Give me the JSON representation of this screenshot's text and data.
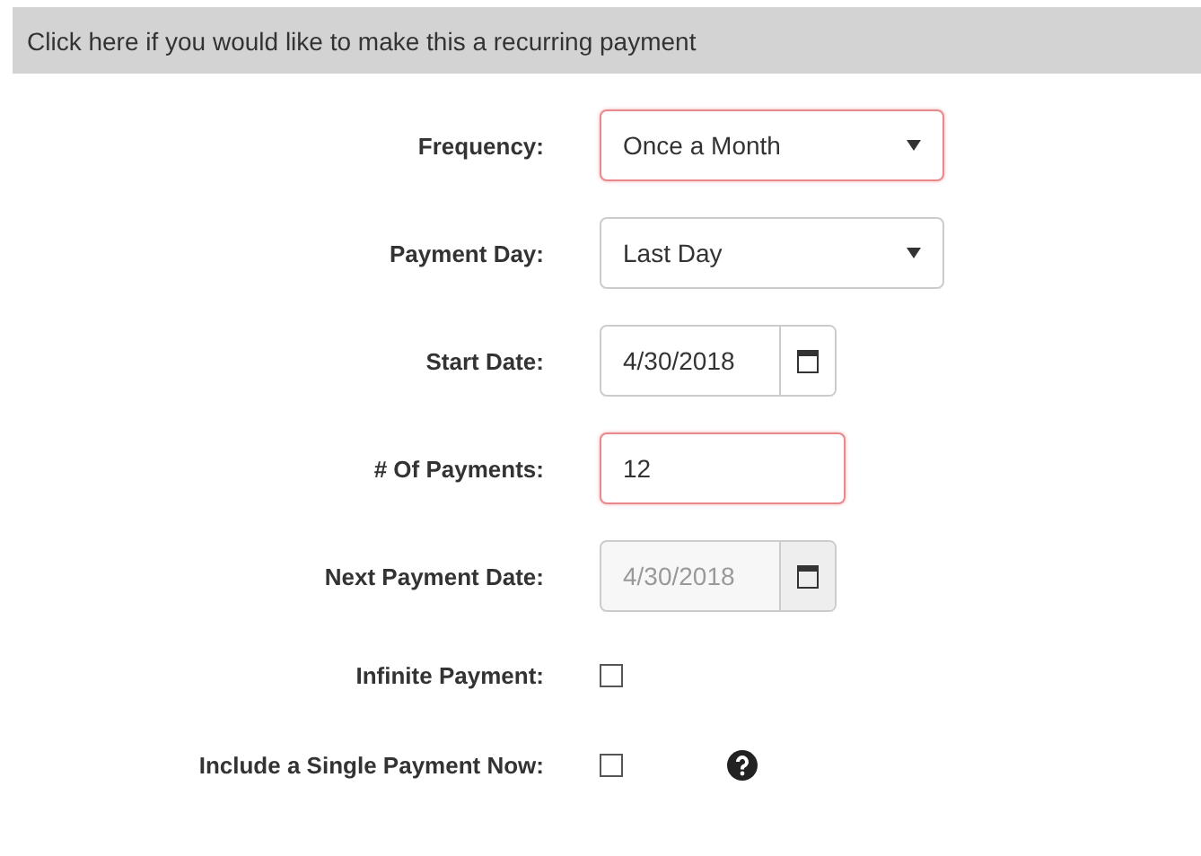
{
  "banner": {
    "text": "Click here if you would like to make this a recurring payment"
  },
  "fields": [
    {
      "label": "Frequency:",
      "kind": "select",
      "value": "Once a Month",
      "invalid": true,
      "disabled": false
    },
    {
      "label": "Payment Day:",
      "kind": "select",
      "value": "Last Day",
      "invalid": false,
      "disabled": false
    },
    {
      "label": "Start Date:",
      "kind": "date",
      "value": "4/30/2018",
      "invalid": false,
      "disabled": false
    },
    {
      "label": "# Of Payments:",
      "kind": "text",
      "value": "12",
      "invalid": true,
      "disabled": false
    },
    {
      "label": "Next Payment Date:",
      "kind": "date",
      "value": "4/30/2018",
      "invalid": false,
      "disabled": true
    },
    {
      "label": "Infinite Payment:",
      "kind": "checkbox",
      "checked": false,
      "help": false
    },
    {
      "label": "Include a Single Payment Now:",
      "kind": "checkbox",
      "checked": false,
      "help": true
    }
  ]
}
